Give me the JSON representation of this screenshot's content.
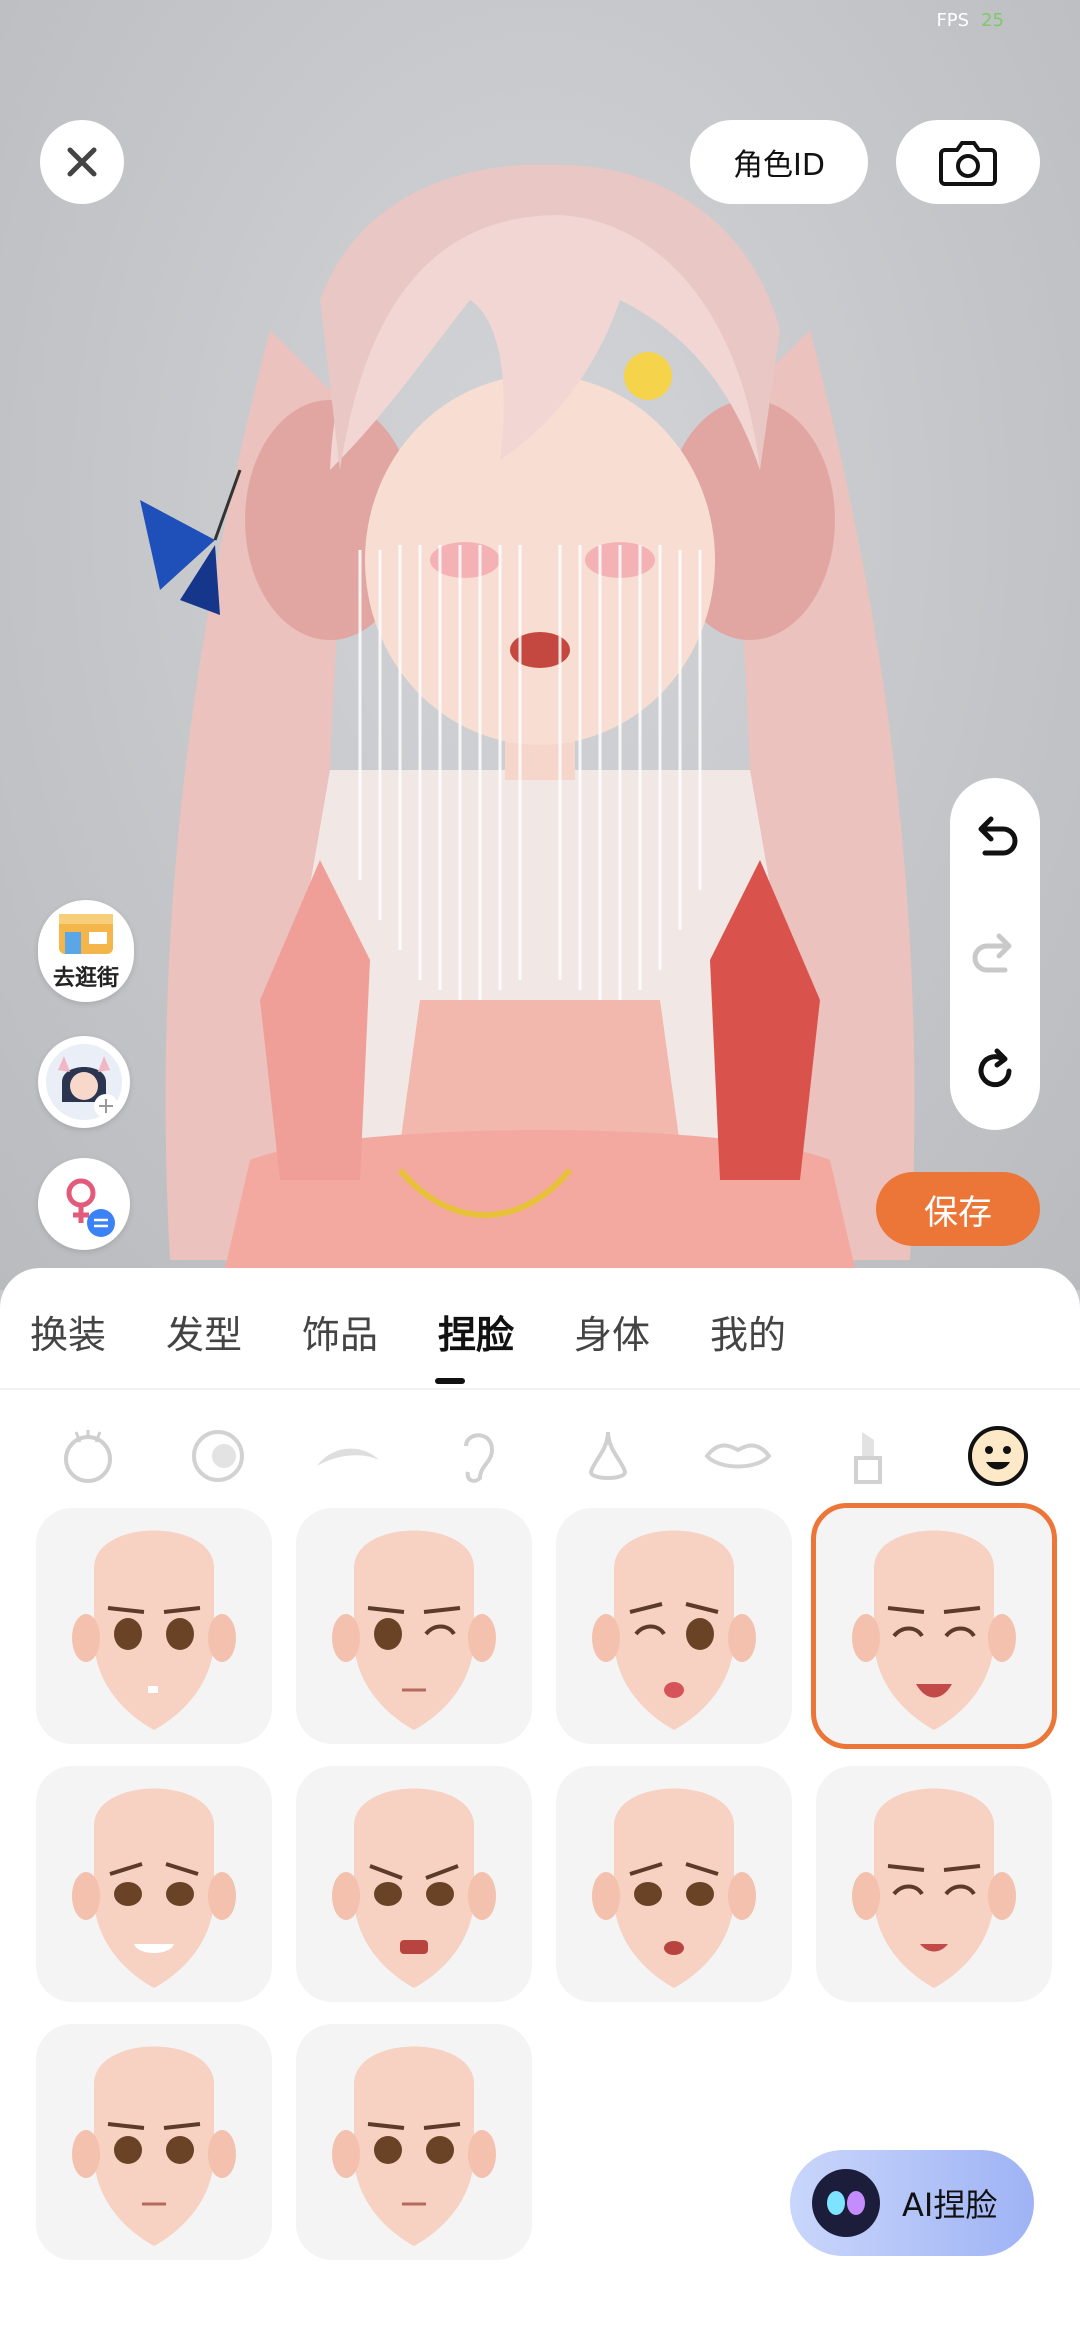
{
  "status": {
    "fps_label": "FPS",
    "fps_value": "25"
  },
  "top_bar": {
    "role_id_label": "角色ID"
  },
  "left_actions": {
    "shop_label": "去逛街"
  },
  "save_label": "保存",
  "tabs": [
    {
      "label": "换装"
    },
    {
      "label": "发型"
    },
    {
      "label": "饰品"
    },
    {
      "label": "捏脸",
      "active": true
    },
    {
      "label": "身体"
    },
    {
      "label": "我的"
    }
  ],
  "face_categories": [
    {
      "icon": "face-shape-icon"
    },
    {
      "icon": "eye-icon"
    },
    {
      "icon": "eyebrow-icon"
    },
    {
      "icon": "ear-icon"
    },
    {
      "icon": "nose-icon"
    },
    {
      "icon": "lips-icon"
    },
    {
      "icon": "lipstick-icon"
    },
    {
      "icon": "expression-icon",
      "selected": true
    }
  ],
  "expressions": [
    {
      "eyes": "open",
      "mouth": "tooth",
      "brows": "normal"
    },
    {
      "eyes": "wink",
      "mouth": "line",
      "brows": "normal"
    },
    {
      "eyes": "wink-left",
      "mouth": "tongue",
      "brows": "worried"
    },
    {
      "eyes": "closed",
      "mouth": "smile-open",
      "brows": "normal",
      "selected": true
    },
    {
      "eyes": "open",
      "mouth": "grin",
      "brows": "worried"
    },
    {
      "eyes": "open",
      "mouth": "open",
      "brows": "angry"
    },
    {
      "eyes": "open",
      "mouth": "small-open",
      "brows": "worried"
    },
    {
      "eyes": "closed",
      "mouth": "smile-open",
      "brows": "normal"
    },
    {
      "eyes": "open",
      "mouth": "line",
      "brows": "normal"
    },
    {
      "eyes": "open",
      "mouth": "line",
      "brows": "normal"
    }
  ],
  "ai_button_label": "AI捏脸",
  "colors": {
    "accent": "#ec7638",
    "skin": "#f7d3c4"
  }
}
